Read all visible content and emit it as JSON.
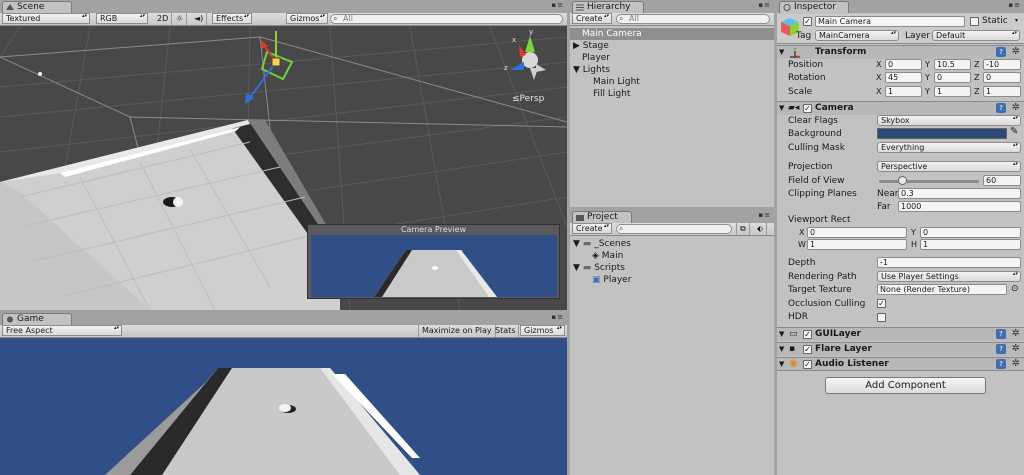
{
  "scene": {
    "tab": "Scene",
    "toolbar": {
      "shading": "Textured",
      "render": "RGB",
      "mode2d": "2D",
      "effects": "Effects",
      "gizmos": "Gizmos",
      "search_placeholder": "All"
    },
    "persp": "Persp",
    "camera_preview_title": "Camera Preview"
  },
  "game": {
    "tab": "Game",
    "aspect": "Free Aspect",
    "maximize": "Maximize on Play",
    "stats": "Stats",
    "gizmos": "Gizmos"
  },
  "hierarchy": {
    "tab": "Hierarchy",
    "create": "Create",
    "search_placeholder": "All",
    "items": [
      {
        "label": "Main Camera",
        "selected": true,
        "depth": 0,
        "foldout": false
      },
      {
        "label": "Stage",
        "depth": 0,
        "foldout": true
      },
      {
        "label": "Player",
        "depth": 0,
        "foldout": false
      },
      {
        "label": "Lights",
        "depth": 0,
        "foldout": true
      },
      {
        "label": "Main Light",
        "depth": 1
      },
      {
        "label": "Fill Light",
        "depth": 1
      }
    ]
  },
  "project": {
    "tab": "Project",
    "create": "Create",
    "items": [
      {
        "label": "_Scenes",
        "type": "folder",
        "depth": 0
      },
      {
        "label": "Main",
        "type": "scene",
        "depth": 1
      },
      {
        "label": "Scripts",
        "type": "folder",
        "depth": 0
      },
      {
        "label": "Player",
        "type": "script",
        "depth": 1
      }
    ]
  },
  "inspector": {
    "tab": "Inspector",
    "name": "Main Camera",
    "static": "Static",
    "tag_label": "Tag",
    "tag": "MainCamera",
    "layer_label": "Layer",
    "layer": "Default",
    "transform": {
      "title": "Transform",
      "position_label": "Position",
      "position": {
        "x": "0",
        "y": "10.5",
        "z": "-10"
      },
      "rotation_label": "Rotation",
      "rotation": {
        "x": "45",
        "y": "0",
        "z": "0"
      },
      "scale_label": "Scale",
      "scale": {
        "x": "1",
        "y": "1",
        "z": "1"
      }
    },
    "camera": {
      "title": "Camera",
      "clear_flags_label": "Clear Flags",
      "clear_flags": "Skybox",
      "background_label": "Background",
      "background_color": "#2b4a78",
      "culling_mask_label": "Culling Mask",
      "culling_mask": "Everything",
      "projection_label": "Projection",
      "projection": "Perspective",
      "fov_label": "Field of View",
      "fov": "60",
      "fov_fraction": 0.24,
      "clipping_label": "Clipping Planes",
      "near_label": "Near",
      "near": "0.3",
      "far_label": "Far",
      "far": "1000",
      "viewport_label": "Viewport Rect",
      "vx": "0",
      "vy": "0",
      "vw": "1",
      "vh": "1",
      "depth_label": "Depth",
      "depth": "-1",
      "rendering_path_label": "Rendering Path",
      "rendering_path": "Use Player Settings",
      "target_texture_label": "Target Texture",
      "target_texture": "None (Render Texture)",
      "occlusion_label": "Occlusion Culling",
      "occlusion": true,
      "hdr_label": "HDR",
      "hdr": false
    },
    "components": [
      {
        "title": "GUILayer"
      },
      {
        "title": "Flare Layer"
      },
      {
        "title": "Audio Listener"
      }
    ],
    "add_component": "Add Component"
  },
  "axis": {
    "x": "X",
    "y": "Y",
    "z": "Z",
    "w": "W",
    "h": "H"
  },
  "colors": {
    "sky": "#2f4f86",
    "selection": "#8f8f8f",
    "help": "#3f6fb0"
  }
}
